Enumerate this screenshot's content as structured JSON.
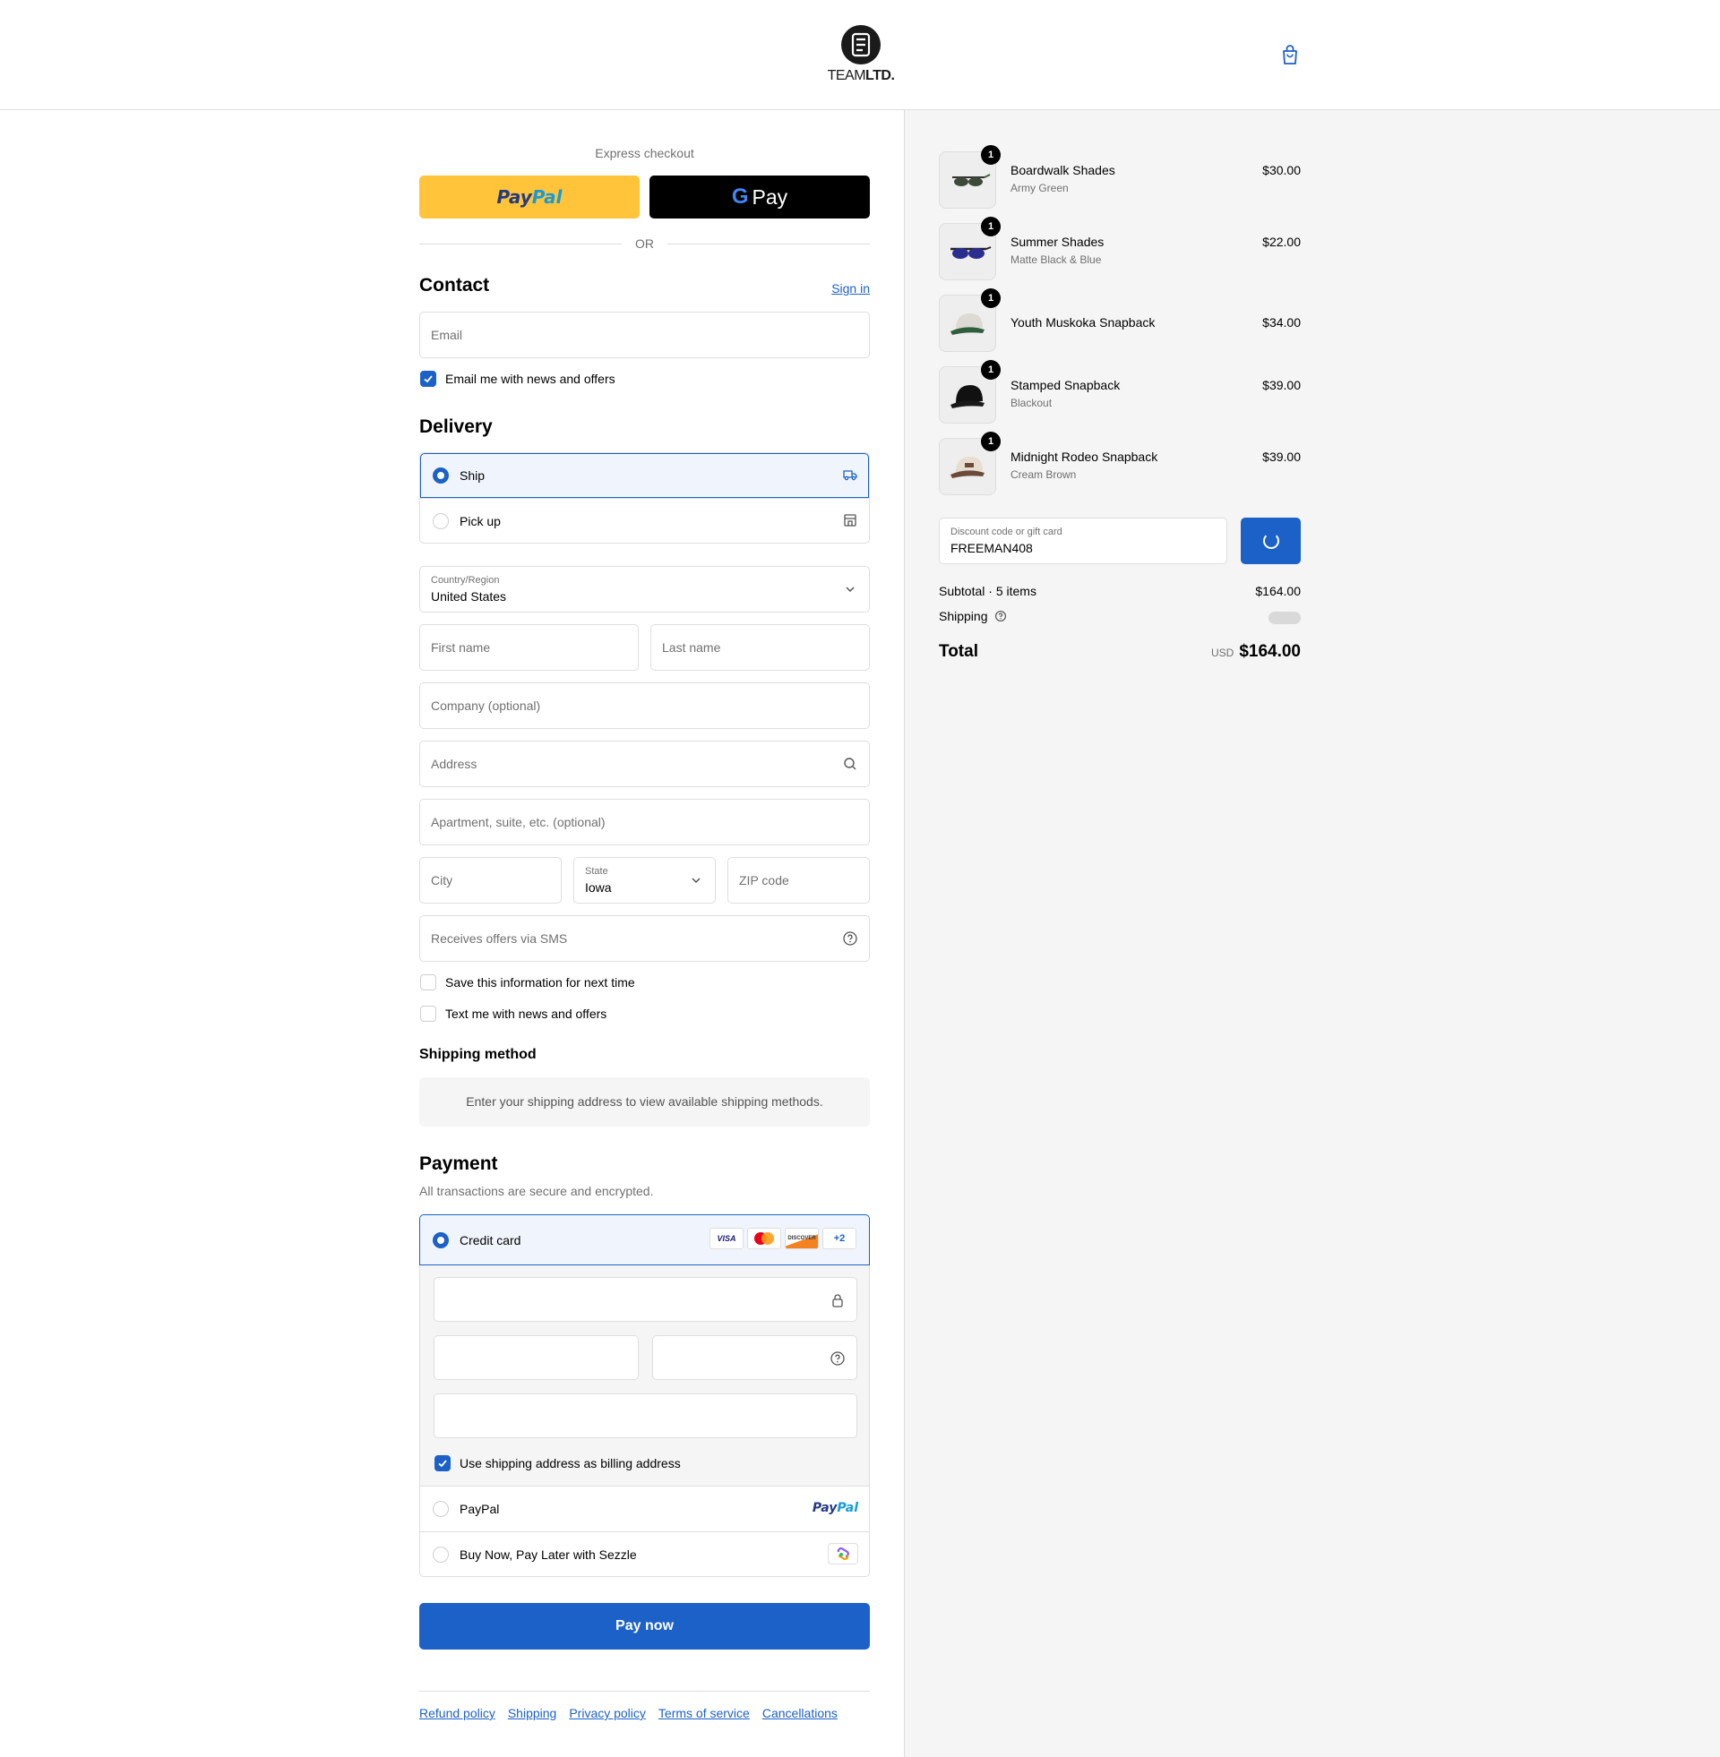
{
  "header": {
    "logo_text_light": "TEAM",
    "logo_text_bold": "LTD."
  },
  "express": {
    "label": "Express checkout",
    "paypal_part1": "Pay",
    "paypal_part2": "Pal",
    "gpay_g": "G",
    "gpay_label": "Pay",
    "or": "OR"
  },
  "contact": {
    "title": "Contact",
    "sign_in": "Sign in",
    "email_placeholder": "Email",
    "news_label": "Email me with news and offers",
    "news_checked": true
  },
  "delivery": {
    "title": "Delivery",
    "options": [
      {
        "label": "Ship",
        "selected": true,
        "icon": "truck-icon"
      },
      {
        "label": "Pick up",
        "selected": false,
        "icon": "store-icon"
      }
    ],
    "country_label": "Country/Region",
    "country_value": "United States",
    "first_name": "First name",
    "last_name": "Last name",
    "company": "Company (optional)",
    "address": "Address",
    "apartment": "Apartment, suite, etc. (optional)",
    "city": "City",
    "state_label": "State",
    "state_value": "Iowa",
    "zip": "ZIP code",
    "sms": "Receives offers via SMS",
    "save_info": "Save this information for next time",
    "text_me": "Text me with news and offers"
  },
  "shipping_method": {
    "title": "Shipping method",
    "note": "Enter your shipping address to view available shipping methods."
  },
  "payment": {
    "title": "Payment",
    "subtitle": "All transactions are secure and encrypted.",
    "credit_card": "Credit card",
    "brands": [
      "VISA",
      "",
      "DISCOVER",
      "+2"
    ],
    "billing_same": "Use shipping address as billing address",
    "paypal": "PayPal",
    "sezzle": "Buy Now, Pay Later with Sezzle"
  },
  "pay_now": "Pay now",
  "footer_links": [
    "Refund policy",
    "Shipping",
    "Privacy policy",
    "Terms of service",
    "Cancellations"
  ],
  "summary": {
    "items": [
      {
        "name": "Boardwalk Shades",
        "variant": "Army Green",
        "price": "$30.00",
        "qty": "1"
      },
      {
        "name": "Summer Shades",
        "variant": "Matte Black & Blue",
        "price": "$22.00",
        "qty": "1"
      },
      {
        "name": "Youth Muskoka Snapback",
        "variant": "",
        "price": "$34.00",
        "qty": "1"
      },
      {
        "name": "Stamped Snapback",
        "variant": "Blackout",
        "price": "$39.00",
        "qty": "1"
      },
      {
        "name": "Midnight Rodeo Snapback",
        "variant": "Cream Brown",
        "price": "$39.00",
        "qty": "1"
      }
    ],
    "discount_label": "Discount code or gift card",
    "discount_value": "FREEMAN408",
    "subtotal_label": "Subtotal · 5 items",
    "subtotal_value": "$164.00",
    "shipping_label": "Shipping",
    "total_label": "Total",
    "total_currency": "USD",
    "total_value": "$164.00"
  },
  "colors": {
    "accent": "#1c61c7",
    "paypal_yellow": "#ffc439"
  }
}
